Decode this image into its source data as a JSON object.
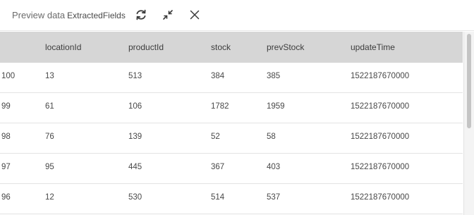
{
  "header": {
    "title_prefix": "Preview data",
    "dataset_name": "ExtractedFields",
    "actions": [
      {
        "icon": "refresh-icon",
        "label": "refresh"
      },
      {
        "icon": "collapse-icon",
        "label": "collapse"
      },
      {
        "icon": "close-icon",
        "label": "close"
      }
    ]
  },
  "table": {
    "columns": [
      "",
      "locationId",
      "productId",
      "stock",
      "prevStock",
      "updateTime"
    ],
    "rows": [
      [
        "100",
        "13",
        "513",
        "384",
        "385",
        "1522187670000"
      ],
      [
        "99",
        "61",
        "106",
        "1782",
        "1959",
        "1522187670000"
      ],
      [
        "98",
        "76",
        "139",
        "52",
        "58",
        "1522187670000"
      ],
      [
        "97",
        "95",
        "445",
        "367",
        "403",
        "1522187670000"
      ],
      [
        "96",
        "12",
        "530",
        "514",
        "537",
        "1522187670000"
      ]
    ]
  }
}
